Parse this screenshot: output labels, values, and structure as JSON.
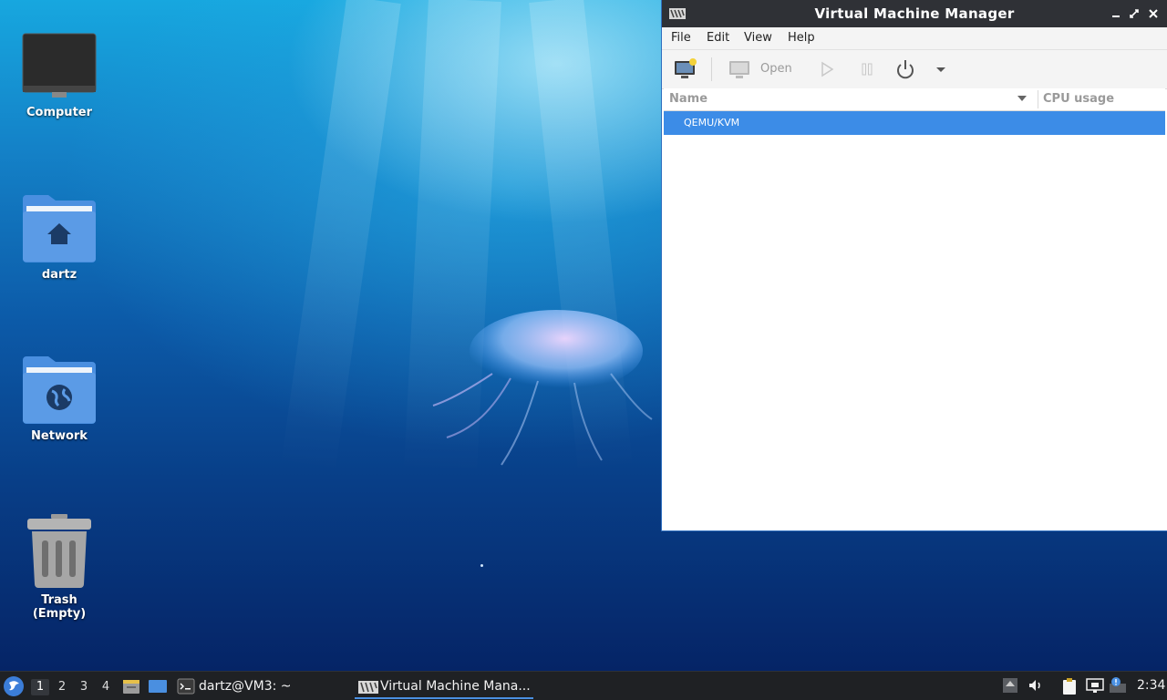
{
  "desktop": {
    "icons": [
      {
        "label": "Computer",
        "icon": "computer-icon"
      },
      {
        "label": "dartz",
        "icon": "home-folder-icon"
      },
      {
        "label": "Network",
        "icon": "network-folder-icon"
      },
      {
        "label": "Trash (Empty)",
        "icon": "trash-icon"
      }
    ]
  },
  "window": {
    "title": "Virtual Machine Manager",
    "controls": [
      "minimize-icon",
      "maximize-icon",
      "close-icon"
    ],
    "menu": [
      "File",
      "Edit",
      "View",
      "Help"
    ],
    "toolbar": {
      "new_vm": "new-vm-icon",
      "open_label": "Open",
      "run": "play-icon",
      "pause": "pause-icon",
      "shutdown": "power-icon",
      "shutdown_menu": "chevron-down-icon"
    },
    "columns": {
      "name": "Name",
      "cpu": "CPU usage"
    },
    "rows": [
      {
        "name": "QEMU/KVM",
        "selected": true
      }
    ]
  },
  "taskbar": {
    "workspaces": [
      "1",
      "2",
      "3",
      "4"
    ],
    "active_workspace": "1",
    "tasks": [
      {
        "label": "dartz@VM3: ~",
        "icon": "terminal-icon"
      },
      {
        "label": "Virtual Machine Mana...",
        "icon": "vmm-icon",
        "active": true
      }
    ],
    "tray": [
      "upload-icon",
      "volume-icon",
      "clipboard-icon",
      "network-icon",
      "notification-icon"
    ],
    "clock": "2:34"
  },
  "colors": {
    "accent": "#3c8ce7",
    "titlebar": "#2f3136",
    "taskbar": "#1f2124"
  }
}
